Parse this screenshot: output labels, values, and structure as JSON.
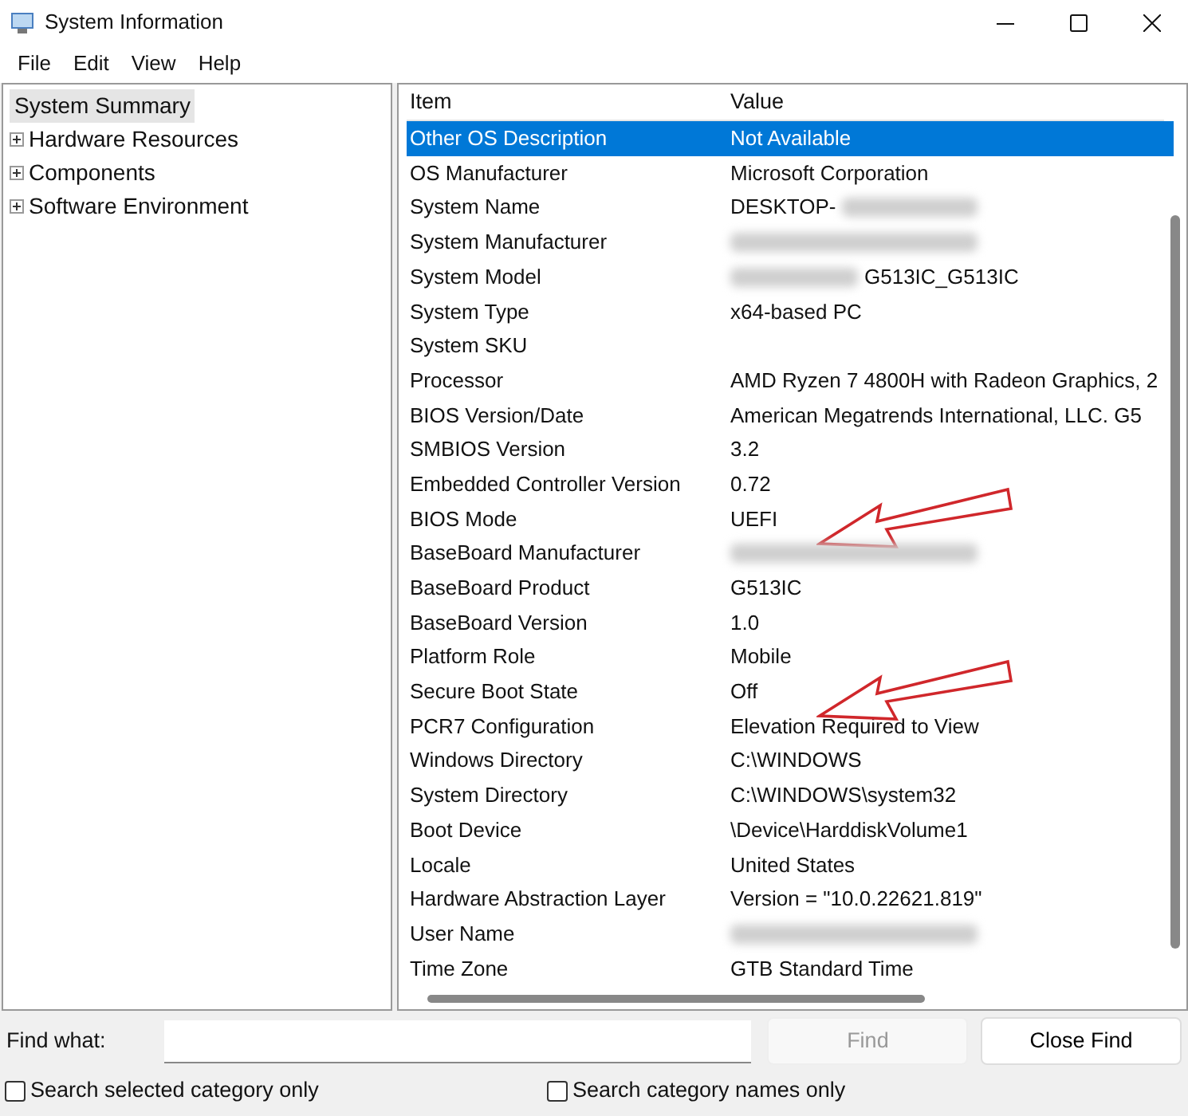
{
  "window": {
    "title": "System Information"
  },
  "menu": [
    "File",
    "Edit",
    "View",
    "Help"
  ],
  "tree": [
    {
      "label": "System Summary",
      "selected": true,
      "expandable": false
    },
    {
      "label": "Hardware Resources",
      "selected": false,
      "expandable": true
    },
    {
      "label": "Components",
      "selected": false,
      "expandable": true
    },
    {
      "label": "Software Environment",
      "selected": false,
      "expandable": true
    }
  ],
  "table": {
    "columns": [
      "Item",
      "Value"
    ],
    "rows": [
      {
        "item": "Other OS Description",
        "value": "Not Available",
        "selected": true,
        "blurred_before": false,
        "blurred_after": false,
        "arrow": false
      },
      {
        "item": "OS Manufacturer",
        "value": "Microsoft Corporation",
        "selected": false,
        "blurred_before": false,
        "blurred_after": false,
        "arrow": false
      },
      {
        "item": "System Name",
        "value": "DESKTOP-",
        "selected": false,
        "blurred_before": false,
        "blurred_after": true,
        "arrow": false
      },
      {
        "item": "System Manufacturer",
        "selected": false,
        "blurred_before": true,
        "blurred_after": false,
        "arrow": false
      },
      {
        "item": "System Model",
        "value": "G513IC_G513IC",
        "selected": false,
        "blurred_before": true,
        "blurred_after": false,
        "arrow": false
      },
      {
        "item": "System Type",
        "value": "x64-based PC",
        "selected": false,
        "blurred_before": false,
        "blurred_after": false,
        "arrow": false
      },
      {
        "item": "System SKU",
        "selected": false,
        "blurred_before": false,
        "blurred_after": false,
        "arrow": false
      },
      {
        "item": "Processor",
        "value": "AMD Ryzen 7 4800H with Radeon Graphics, 2",
        "selected": false,
        "blurred_before": false,
        "blurred_after": false,
        "arrow": false
      },
      {
        "item": "BIOS Version/Date",
        "value": "American Megatrends International, LLC. G5",
        "selected": false,
        "blurred_before": false,
        "blurred_after": false,
        "arrow": false
      },
      {
        "item": "SMBIOS Version",
        "value": "3.2",
        "selected": false,
        "blurred_before": false,
        "blurred_after": false,
        "arrow": false
      },
      {
        "item": "Embedded Controller Version",
        "value": "0.72",
        "selected": false,
        "blurred_before": false,
        "blurred_after": false,
        "arrow": false
      },
      {
        "item": "BIOS Mode",
        "value": "UEFI",
        "selected": false,
        "blurred_before": false,
        "blurred_after": false,
        "arrow": true
      },
      {
        "item": "BaseBoard Manufacturer",
        "selected": false,
        "blurred_before": true,
        "blurred_after": false,
        "arrow": false
      },
      {
        "item": "BaseBoard Product",
        "value": "G513IC",
        "selected": false,
        "blurred_before": false,
        "blurred_after": false,
        "arrow": false
      },
      {
        "item": "BaseBoard Version",
        "value": "1.0",
        "selected": false,
        "blurred_before": false,
        "blurred_after": false,
        "arrow": false
      },
      {
        "item": "Platform Role",
        "value": "Mobile",
        "selected": false,
        "blurred_before": false,
        "blurred_after": false,
        "arrow": false
      },
      {
        "item": "Secure Boot State",
        "value": "Off",
        "selected": false,
        "blurred_before": false,
        "blurred_after": false,
        "arrow": true
      },
      {
        "item": "PCR7 Configuration",
        "value": "Elevation Required to View",
        "selected": false,
        "blurred_before": false,
        "blurred_after": false,
        "arrow": false
      },
      {
        "item": "Windows Directory",
        "value": "C:\\WINDOWS",
        "selected": false,
        "blurred_before": false,
        "blurred_after": false,
        "arrow": false
      },
      {
        "item": "System Directory",
        "value": "C:\\WINDOWS\\system32",
        "selected": false,
        "blurred_before": false,
        "blurred_after": false,
        "arrow": false
      },
      {
        "item": "Boot Device",
        "value": "\\Device\\HarddiskVolume1",
        "selected": false,
        "blurred_before": false,
        "blurred_after": false,
        "arrow": false
      },
      {
        "item": "Locale",
        "value": "United States",
        "selected": false,
        "blurred_before": false,
        "blurred_after": false,
        "arrow": false
      },
      {
        "item": "Hardware Abstraction Layer",
        "value": "Version = \"10.0.22621.819\"",
        "selected": false,
        "blurred_before": false,
        "blurred_after": false,
        "arrow": false
      },
      {
        "item": "User Name",
        "selected": false,
        "blurred_before": true,
        "blurred_after": false,
        "arrow": false
      },
      {
        "item": "Time Zone",
        "value": "GTB Standard Time",
        "selected": false,
        "blurred_before": false,
        "blurred_after": false,
        "arrow": false
      }
    ]
  },
  "find": {
    "label": "Find what:",
    "find_button": "Find",
    "find_disabled": true,
    "close_button": "Close Find"
  },
  "options": [
    {
      "label": "Search selected category only",
      "checked": false
    },
    {
      "label": "Search category names only",
      "checked": false
    }
  ]
}
